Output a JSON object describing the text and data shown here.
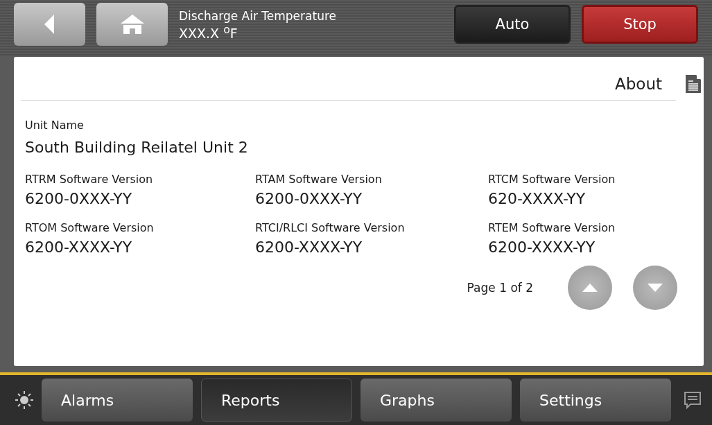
{
  "header": {
    "label": "Discharge Air Temperature",
    "value": "XXX.X $^{o}$F",
    "modes": [
      {
        "label": "Auto",
        "kind": "normal"
      },
      {
        "label": "Stop",
        "kind": "stop"
      }
    ]
  },
  "page_title": "About",
  "unit": {
    "label": "Unit Name",
    "value": "South Building Reilatel Unit 2"
  },
  "versions": [
    {
      "label": "RTRM Software Version",
      "value": "6200-0XXX-YY"
    },
    {
      "label": "RTAM Software Version",
      "value": "6200-0XXX-YY"
    },
    {
      "label": "RTCM Software Version",
      "value": "620-XXXX-YY"
    },
    {
      "label": "RTOM Software Version",
      "value": "6200-XXXX-YY"
    },
    {
      "label": "RTCI/RLCI Software Version",
      "value": "6200-XXXX-YY"
    },
    {
      "label": "RTEM Software Version",
      "value": "6200-XXXX-YY"
    }
  ],
  "pager": "Page 1 of 2",
  "tabs": [
    {
      "label": "Alarms",
      "selected": false
    },
    {
      "label": "Reports",
      "selected": true
    },
    {
      "label": "Graphs",
      "selected": false
    },
    {
      "label": "Settings",
      "selected": false
    }
  ]
}
